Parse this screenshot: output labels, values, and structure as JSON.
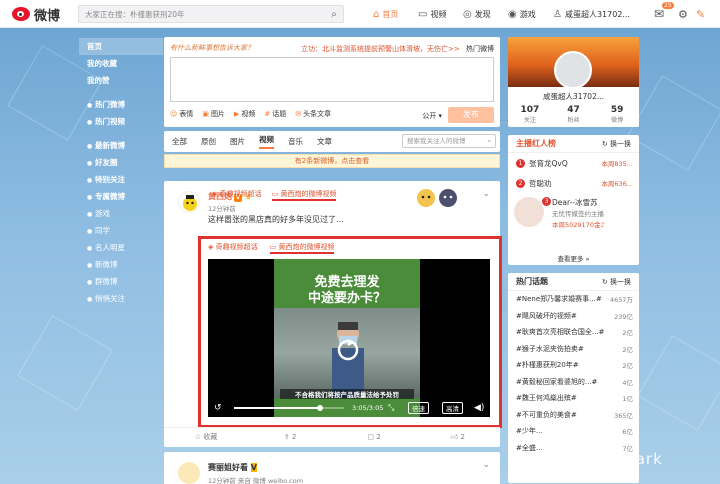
{
  "nav": {
    "logo_text": "微博",
    "search_placeholder": "大家正在搜：朴槿惠获刑20年",
    "items": [
      {
        "label": "首页",
        "icon": "home-icon",
        "active": true
      },
      {
        "label": "视频",
        "icon": "video-icon",
        "active": false
      },
      {
        "label": "发现",
        "icon": "compass-icon",
        "active": false
      },
      {
        "label": "游戏",
        "icon": "gamepad-icon",
        "active": false
      },
      {
        "label": "咸蛋超人31702...",
        "icon": "user-icon",
        "active": false
      }
    ],
    "message_badge": "25",
    "accent": "#fa7d3c"
  },
  "sidebar": {
    "items": [
      {
        "label": "首页",
        "bold": true,
        "bullet": ""
      },
      {
        "label": "我的收藏",
        "bold": true,
        "bullet": ""
      },
      {
        "label": "我的赞",
        "bold": true,
        "bullet": ""
      },
      {
        "label": "热门微博",
        "bold": true,
        "bullet": "●"
      },
      {
        "label": "热门视频",
        "bold": true,
        "bullet": "●"
      },
      {
        "label": "最新微博",
        "bold": true,
        "bullet": "●"
      },
      {
        "label": "好友圈",
        "bold": true,
        "bullet": "●"
      },
      {
        "label": "特别关注",
        "bold": true,
        "bullet": "●"
      },
      {
        "label": "专属微博",
        "bold": true,
        "bullet": "●"
      },
      {
        "label": "游戏",
        "bold": false,
        "bullet": "●"
      },
      {
        "label": "同学",
        "bold": false,
        "bullet": "●"
      },
      {
        "label": "名人明星",
        "bold": false,
        "bullet": "●"
      },
      {
        "label": "新微博",
        "bold": false,
        "bullet": "●"
      },
      {
        "label": "群微博",
        "bold": false,
        "bullet": "●"
      },
      {
        "label": "悄悄关注",
        "bold": false,
        "bullet": "●"
      }
    ]
  },
  "composer": {
    "hint": "有什么新鲜事想告诉大家？",
    "hot_prefix": "立功",
    "hot_text": "：北斗监测系统提前预警山体滑坡，无伤亡>>",
    "hot_link": "热门微博",
    "tools": [
      "表情",
      "图片",
      "视频",
      "话题",
      "头条文章"
    ],
    "tool_icons": [
      "smile-icon",
      "image-icon",
      "video-icon",
      "hashtag-icon",
      "article-icon"
    ],
    "public": "公开 ▾",
    "publish": "发布"
  },
  "tabs": {
    "items": [
      "全部",
      "原创",
      "图片",
      "视频",
      "音乐",
      "文章"
    ],
    "active_index": 3,
    "search_placeholder": "搜索我关注人的微博"
  },
  "notice": "有2条新微博，点击查看",
  "post": {
    "author": "黄西炮",
    "time": "12分钟前",
    "text": "这样嚣张的黑店真的好多年没见过了...",
    "link1": "奇趣视频超话",
    "link2": "黄西炮的微博视频",
    "video": {
      "title_line1": "免费去理发",
      "title_line2": "中途要办卡？",
      "subtitle": "不合格我们将按产品质量法给予处罚",
      "time": "3:05/3:05",
      "quality": "倍速",
      "hd": "高清",
      "progress": 0.78
    },
    "actions": [
      "收藏",
      "2",
      "2",
      "2"
    ]
  },
  "post2": {
    "author": "赛丽姐好看",
    "time": "12分钟前 来自 微博 weibo.com"
  },
  "profile": {
    "name": "咸蛋超人31702...",
    "stats": [
      {
        "n": "107",
        "l": "关注"
      },
      {
        "n": "47",
        "l": "粉丝"
      },
      {
        "n": "59",
        "l": "微博"
      }
    ]
  },
  "redlist": {
    "title": "主播红人榜",
    "swap": "换一换",
    "items": [
      {
        "rank": "1",
        "name": "张育龙QvQ",
        "meta": "本周835..."
      },
      {
        "rank": "2",
        "name": "哲聪劝",
        "meta": "本周636..."
      }
    ],
    "dear": {
      "rank": "3",
      "name": "Dear--冰雪苏",
      "sub": "无忧传媒签约主播",
      "rec": "本周5029170金♪"
    },
    "more": "查看更多 »"
  },
  "hot": {
    "title": "热门话题",
    "swap": "换一换",
    "items": [
      {
        "q": "#Nene郑乃馨求婚赛事...#",
        "c": "4657万"
      },
      {
        "q": "#飓风破坏的视频#",
        "c": "239亿"
      },
      {
        "q": "#耿爽首次亮相联合国全...#",
        "c": "2亿"
      },
      {
        "q": "#猴子水泥夹伤拍卖#",
        "c": "2亿"
      },
      {
        "q": "#朴槿惠获刑20年#",
        "c": "2亿"
      },
      {
        "q": "#黄毅秘回家看婆旭的...#",
        "c": "4亿"
      },
      {
        "q": "#魏王何鸿燊出殡#",
        "c": "1亿"
      },
      {
        "q": "#不可重负的美食#",
        "c": "365亿"
      },
      {
        "q": "#少年...",
        "c": "6亿"
      },
      {
        "q": "#全盛...",
        "c": "7亿"
      }
    ]
  },
  "watermark": "知乎 @JackStark"
}
